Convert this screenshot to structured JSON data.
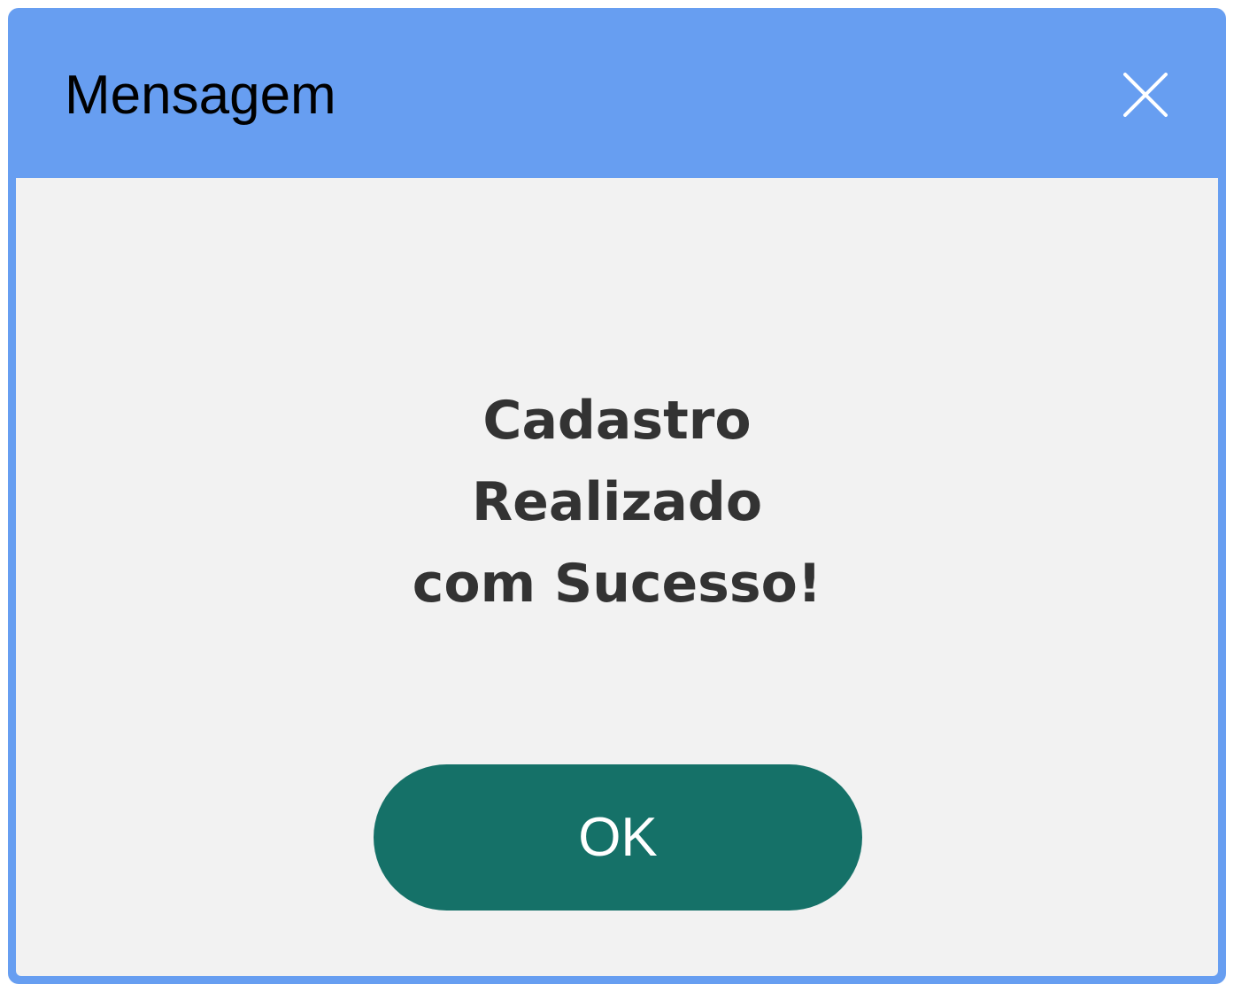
{
  "dialog": {
    "title": "Mensagem",
    "close_icon": "close-icon",
    "message_lines": [
      "Cadastro",
      "Realizado",
      "com Sucesso!"
    ],
    "ok_label": "OK"
  },
  "colors": {
    "header": "#679ef1",
    "body_background": "#f2f2f2",
    "message_text": "#333333",
    "ok_button": "#157168",
    "ok_text": "#ffffff"
  }
}
